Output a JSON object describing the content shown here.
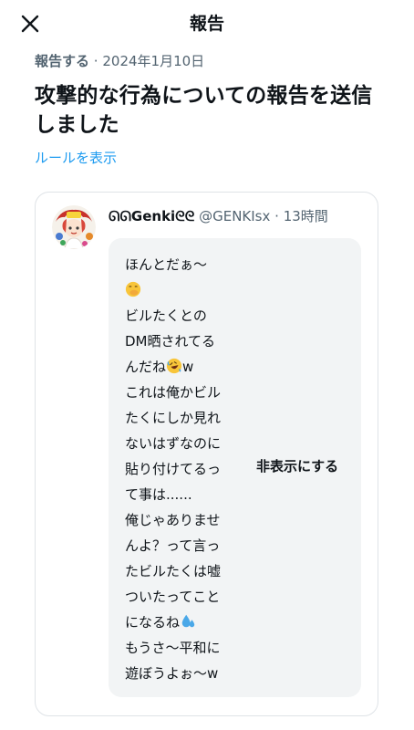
{
  "header": {
    "title": "報告",
    "close_icon": "close-icon"
  },
  "report": {
    "status": "報告する",
    "separator": "·",
    "date": "2024年1月10日",
    "title": "攻撃的な行為についての報告を送信しました",
    "rules_link": "ルールを表示"
  },
  "tweet": {
    "display_name": "ᘏᘏGenkiᘓᘓ",
    "handle": "@GENKIsx",
    "separator": "·",
    "time": "13時間",
    "lines": [
      "ほんとだぁ〜",
      "",
      "ビルたくとの",
      "DM晒されてる",
      "んだね",
      "これは俺かビル",
      "たくにしか見れ",
      "ないはずなのに",
      "貼り付けてるっ",
      "て事は......",
      "俺じゃありませ",
      "んよ？って言っ",
      "たビルたくは嘘",
      "ついたってこと",
      "になるね",
      "もうさ〜平和に",
      "遊ぼうよぉ〜w"
    ],
    "line5_suffix": "w",
    "emojis": [
      "face-with-hand-over-mouth-icon",
      "rolling-on-floor-laughing-icon",
      "sweat-droplets-icon"
    ],
    "hide_label": "非表示にする"
  },
  "colors": {
    "link": "#1d9bf0",
    "secondary_text": "#536471",
    "hidden_panel_bg": "#f2f4f5"
  }
}
